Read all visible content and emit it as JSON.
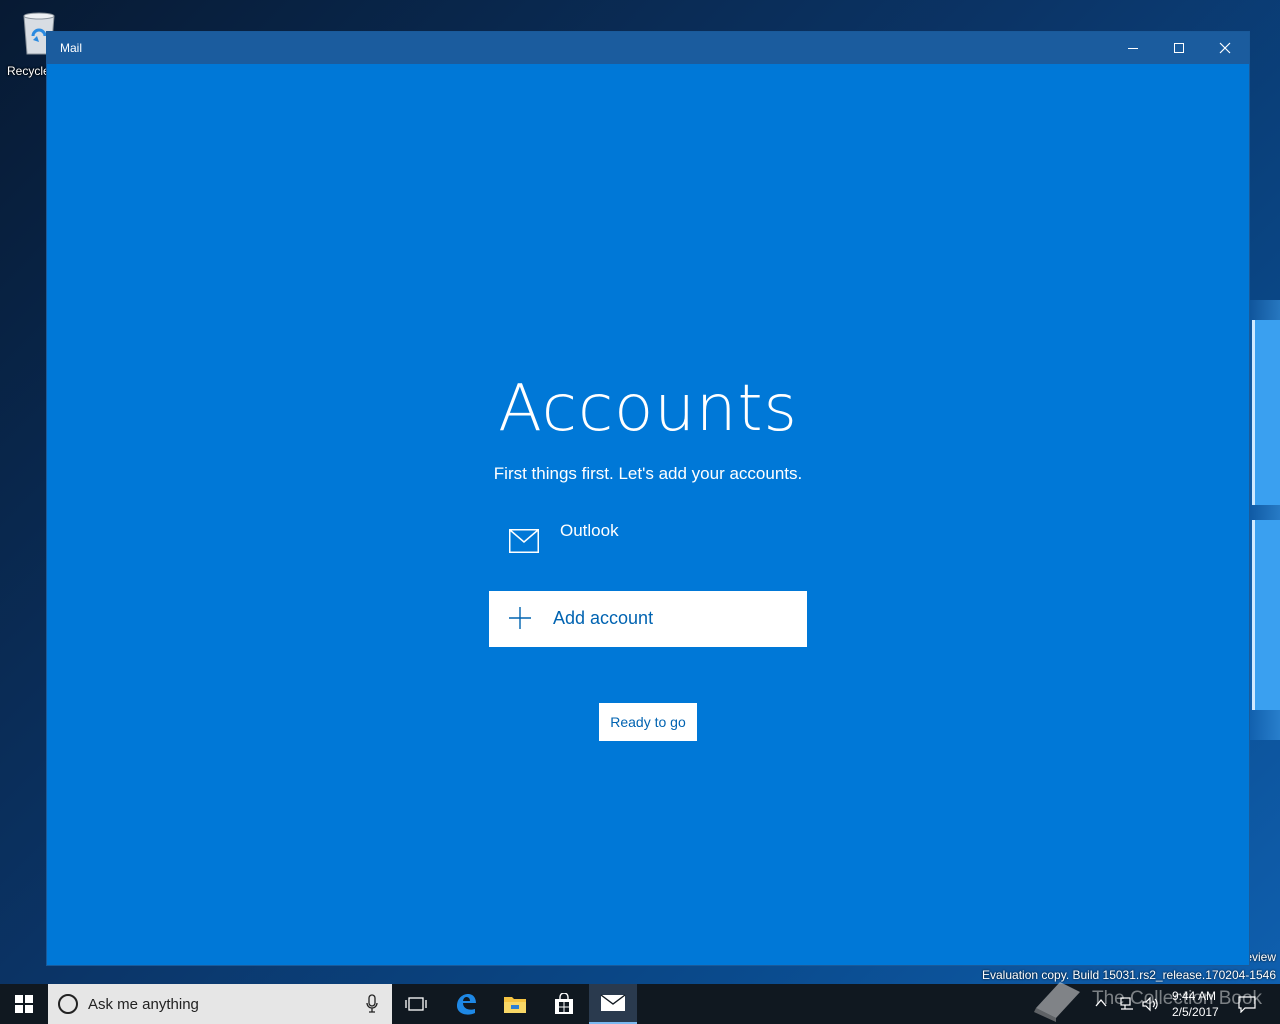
{
  "desktop": {
    "recycle_bin_label": "Recycle",
    "watermark_preview": "eview",
    "watermark_build": "Evaluation copy. Build 15031.rs2_release.170204-1546"
  },
  "window": {
    "title": "Mail",
    "accent_color": "#0078d7",
    "titlebar_color": "#1b5c9e"
  },
  "accounts_page": {
    "heading": "Accounts",
    "subheading": "First things first. Let's add your accounts.",
    "accounts": [
      {
        "icon": "mail-envelope-icon",
        "name": "Outlook"
      }
    ],
    "add_account_label": "Add account",
    "ready_label": "Ready to go"
  },
  "taskbar": {
    "search_placeholder": "Ask me anything",
    "clock_time": "9:44 AM",
    "clock_date": "2/5/2017",
    "overlay_text": "The Collection Book"
  }
}
